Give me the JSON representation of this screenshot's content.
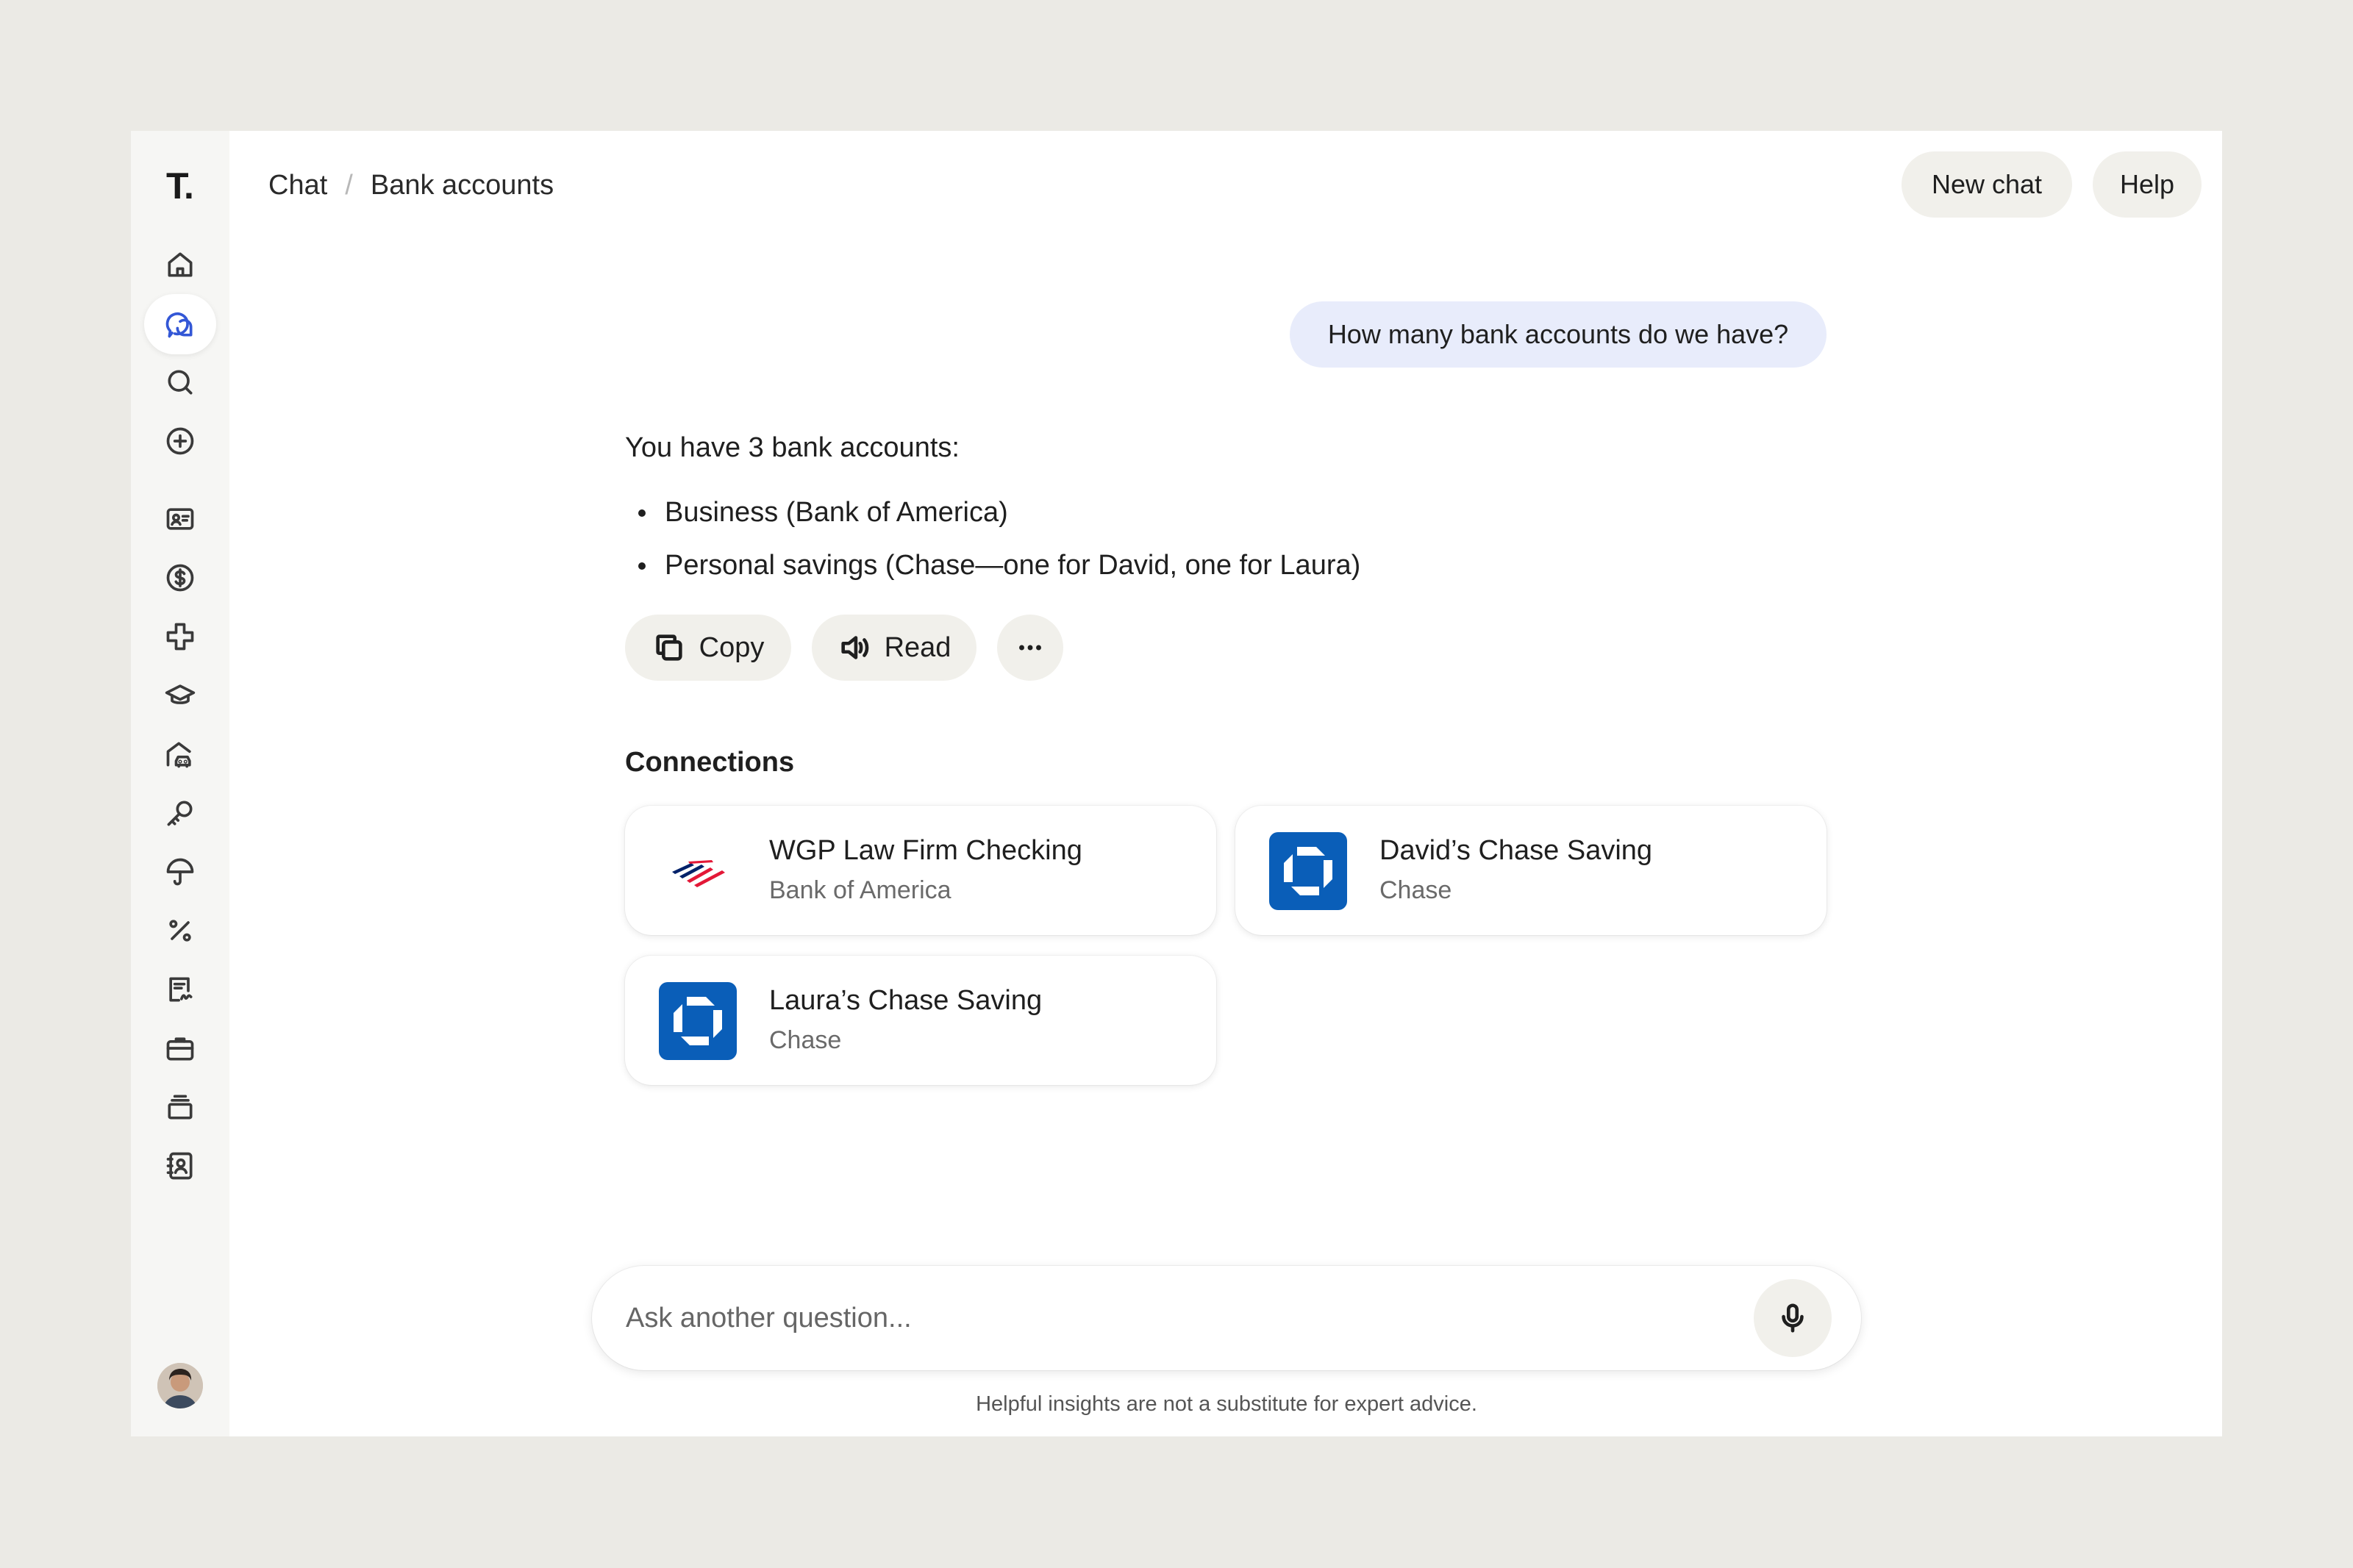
{
  "app": {
    "logo": "T."
  },
  "breadcrumb": {
    "parent": "Chat",
    "separator": "/",
    "current": "Bank accounts"
  },
  "header": {
    "new_chat": "New chat",
    "help": "Help"
  },
  "sidebar": {
    "items": [
      {
        "name": "home-icon"
      },
      {
        "name": "chat-icon",
        "active": true
      },
      {
        "name": "search-icon"
      },
      {
        "name": "plus-circle-icon"
      },
      {
        "name": "id-card-icon"
      },
      {
        "name": "dollar-circle-icon"
      },
      {
        "name": "medical-cross-icon"
      },
      {
        "name": "graduation-cap-icon"
      },
      {
        "name": "house-car-icon"
      },
      {
        "name": "key-icon"
      },
      {
        "name": "umbrella-icon"
      },
      {
        "name": "percent-icon"
      },
      {
        "name": "signed-document-icon"
      },
      {
        "name": "briefcase-icon"
      },
      {
        "name": "stack-icon"
      },
      {
        "name": "contacts-icon"
      }
    ]
  },
  "conversation": {
    "user_message": "How many bank accounts do we have?",
    "answer_intro": "You have 3 bank accounts:",
    "answer_bullets": [
      "Business (Bank of America)",
      "Personal savings (Chase—one for David, one for Laura)"
    ],
    "actions": {
      "copy": "Copy",
      "read": "Read",
      "more": "more-icon"
    }
  },
  "connections": {
    "title": "Connections",
    "items": [
      {
        "name": "WGP Law Firm Checking",
        "institution": "Bank of America",
        "logo": "bank-of-america-logo"
      },
      {
        "name": "David’s Chase Saving",
        "institution": "Chase",
        "logo": "chase-logo"
      },
      {
        "name": "Laura’s Chase Saving",
        "institution": "Chase",
        "logo": "chase-logo"
      }
    ]
  },
  "composer": {
    "placeholder": "Ask another question...",
    "disclaimer": "Helpful insights are not a substitute for expert advice."
  },
  "colors": {
    "accent": "#3357d6",
    "user_bubble": "#e8ecfb",
    "chase_blue": "#0a5eb8",
    "boa_red": "#e31837",
    "boa_blue": "#012169"
  }
}
